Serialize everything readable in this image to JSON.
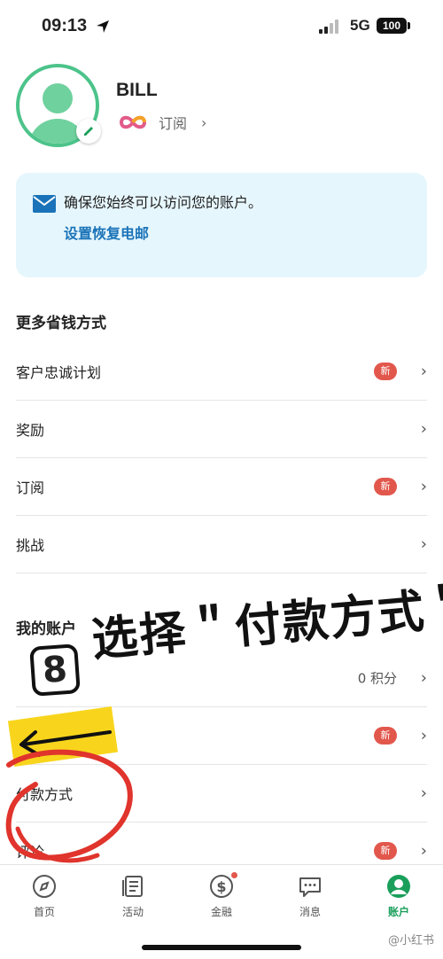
{
  "status_bar": {
    "time": "09:13",
    "network": "5G",
    "battery": "100"
  },
  "profile": {
    "name": "BILL",
    "subscription_label": "订阅",
    "subscription_chevron": "›"
  },
  "notice": {
    "message": "确保您始终可以访问您的账户。",
    "link": "设置恢复电邮"
  },
  "section_more": {
    "title": "更多省钱方式",
    "items": [
      {
        "label": "客户忠诚计划",
        "badge": "新",
        "chevron": "›"
      },
      {
        "label": "奖励",
        "chevron": "›"
      },
      {
        "label": "订阅",
        "badge": "新",
        "chevron": "›"
      },
      {
        "label": "挑战",
        "chevron": "›"
      }
    ]
  },
  "section_account": {
    "title": "我的账户",
    "items": [
      {
        "value": "0 积分",
        "chevron": "›"
      },
      {
        "badge": "新",
        "chevron": "›"
      },
      {
        "label": "付款方式",
        "chevron": "›"
      },
      {
        "label": "评论",
        "badge": "新",
        "chevron": "›"
      }
    ]
  },
  "overlay": {
    "step_number": "8",
    "instruction": "选择＂付款方式＂"
  },
  "tabbar": {
    "tabs": [
      {
        "label": "首页",
        "icon": "compass-icon"
      },
      {
        "label": "活动",
        "icon": "document-icon"
      },
      {
        "label": "金融",
        "icon": "dollar-icon"
      },
      {
        "label": "消息",
        "icon": "chat-icon"
      },
      {
        "label": "账户",
        "icon": "person-icon"
      }
    ]
  },
  "watermark": "@小红书",
  "colors": {
    "accent": "#1a9f5b",
    "badge": "#e2574c",
    "link": "#1a73b8",
    "notice_bg": "#e6f6fd"
  }
}
